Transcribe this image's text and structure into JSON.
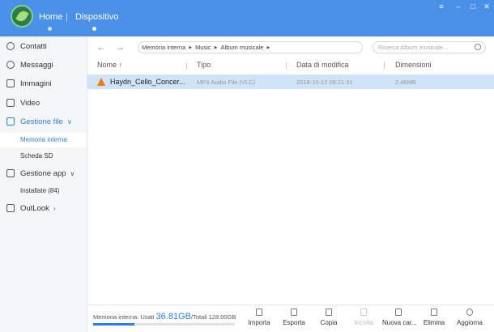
{
  "header": {
    "tabs": [
      {
        "label": "Home"
      },
      {
        "label": "Dispositivo"
      }
    ],
    "window_controls": [
      "≡",
      "–",
      "□",
      "✕"
    ]
  },
  "sidebar": {
    "items": [
      {
        "label": "Contatti",
        "icon": "person-icon"
      },
      {
        "label": "Messaggi",
        "icon": "chat-icon"
      },
      {
        "label": "Immagini",
        "icon": "image-icon"
      },
      {
        "label": "Video",
        "icon": "video-icon"
      },
      {
        "label": "Gestione file",
        "icon": "folder-icon",
        "chevron": "∨"
      },
      {
        "label": "Gestione app",
        "icon": "apps-icon",
        "chevron": "∨"
      },
      {
        "label": "OutLook",
        "icon": "mail-icon",
        "chevron": "›"
      }
    ],
    "file_sub": [
      {
        "label": "Memoria interna"
      },
      {
        "label": "Scheda SD"
      }
    ],
    "app_sub": [
      {
        "label": "Installate (84)"
      }
    ]
  },
  "toolbar": {
    "back": "←",
    "forward": "→",
    "breadcrumb": [
      "Memoria interna",
      "Music",
      "Album musicale"
    ],
    "search_placeholder": "Ricerca Album musicale..."
  },
  "table": {
    "columns": [
      "Nome ↑",
      "Tipo",
      "Data di modifica",
      "Dimensioni"
    ],
    "rows": [
      {
        "name": "Haydn_Cello_Concer...",
        "type": "MP3 Audio File (VLC)",
        "date": "2018-10-12 09:21:31",
        "size": "2.46MB"
      }
    ]
  },
  "footer": {
    "storage_prefix": "Memoria interna: Usati ",
    "storage_used": "36.81GB",
    "storage_total": "/Totali 128.00GB",
    "storage_fraction": 0.29,
    "actions": [
      {
        "label": "Importa",
        "enabled": true
      },
      {
        "label": "Esporta",
        "enabled": true
      },
      {
        "label": "Copia",
        "enabled": true
      },
      {
        "label": "Incolla",
        "enabled": false
      },
      {
        "label": "Nuova car...",
        "enabled": true
      },
      {
        "label": "Elimina",
        "enabled": true
      },
      {
        "label": "Aggiorna",
        "enabled": true
      }
    ]
  },
  "colors": {
    "header": "#4a90e8",
    "accent": "#2b7de9",
    "selected_row": "#cfe3f9"
  }
}
